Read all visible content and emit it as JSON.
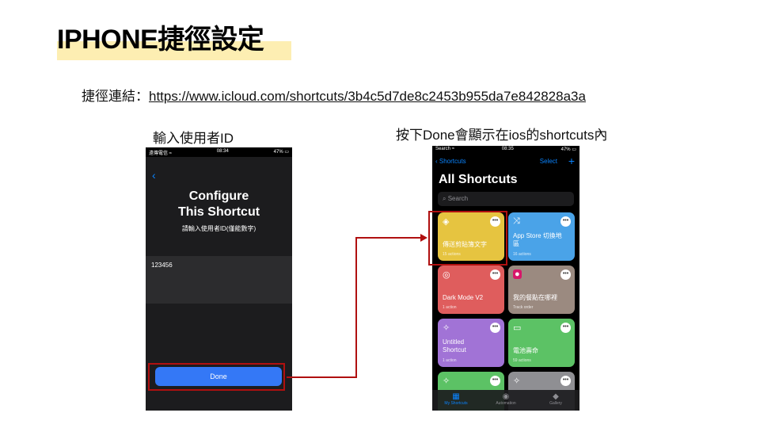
{
  "title": "IPHONE捷徑設定",
  "link": {
    "label": "捷徑連結：",
    "url": "https://www.icloud.com/shortcuts/3b4c5d7de8c2453b955da7e842828a3a"
  },
  "captions": {
    "left": "輸入使用者ID",
    "right": "按下Done會顯示在ios的shortcuts內"
  },
  "phone1": {
    "status_left": "遠傳電信 ",
    "status_time": "08:34",
    "status_right": "47% ",
    "back_icon": "chevron-left-icon",
    "title_line1": "Configure",
    "title_line2": "This Shortcut",
    "subtitle": "請輸入使用者ID(僅能數字)",
    "input_value": "123456",
    "done_label": "Done"
  },
  "phone2": {
    "status_left": "Search ",
    "status_time": "08:35",
    "status_right": "47% ",
    "nav_back": "Shortcuts",
    "nav_select": "Select",
    "nav_plus": "+",
    "heading": "All Shortcuts",
    "search_placeholder": "Search",
    "tiles": [
      {
        "name": "傳送剪貼簿文字",
        "actions": "15 actions",
        "color": "#e6c440",
        "icon": "layers-icon"
      },
      {
        "name": "App Store 切換地區",
        "actions": "16 actions",
        "color": "#4aa3e8",
        "icon": "shuffle-icon"
      },
      {
        "name": "Dark Mode V2",
        "actions": "1 action",
        "color": "#df5d5d",
        "icon": "compass-icon"
      },
      {
        "name": "我的餐點在哪裡",
        "actions": "Track order",
        "color": "#9b8a80",
        "icon": "foodpanda-icon"
      },
      {
        "name": "Untitled Shortcut",
        "actions": "1 action",
        "color": "#a173d6",
        "icon": "magic-wand-icon"
      },
      {
        "name": "電池壽命",
        "actions": "59 actions",
        "color": "#5cc265",
        "icon": "battery-icon"
      },
      {
        "name": "",
        "actions": "",
        "color": "#5cc265",
        "icon": "magic-wand-icon"
      },
      {
        "name": "",
        "actions": "",
        "color": "#8f8f93",
        "icon": "magic-wand-icon"
      }
    ],
    "tabs": [
      {
        "label": "My Shortcuts",
        "icon": "grid-icon"
      },
      {
        "label": "Automation",
        "icon": "check-circle-icon"
      },
      {
        "label": "Gallery",
        "icon": "stack-icon"
      }
    ]
  },
  "colors": {
    "highlight": "#b01010",
    "title_highlight": "#fdeeb2",
    "ios_blue": "#3478f6"
  }
}
